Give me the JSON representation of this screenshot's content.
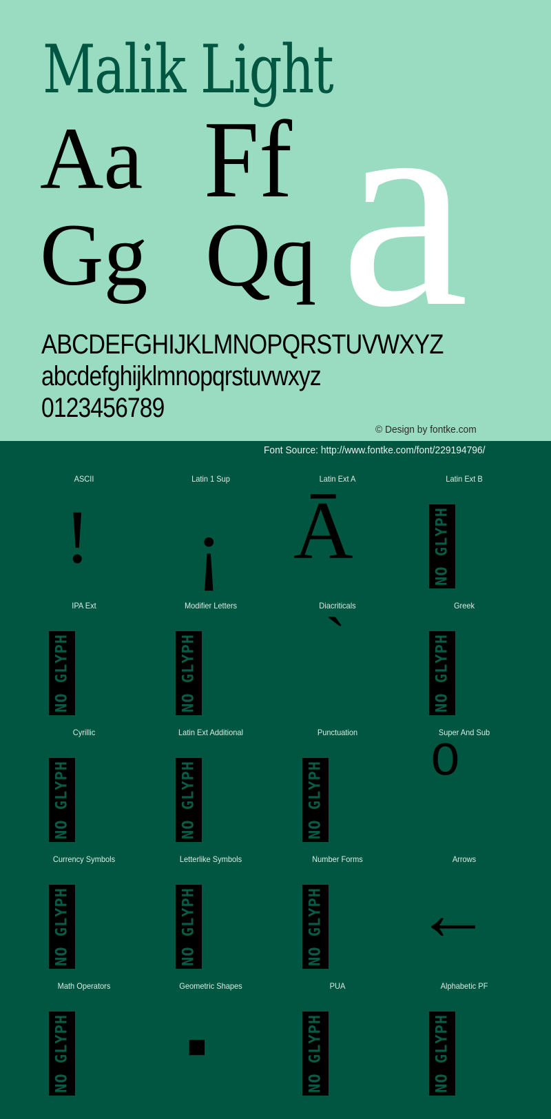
{
  "header": {
    "title": "Malik Light",
    "pairs": [
      "Aa",
      "Ff",
      "Gg",
      "Qq"
    ],
    "big_glyph": "a",
    "uppercase": "ABCDEFGHIJKLMNOPQRSTUVWXYZ",
    "lowercase": "abcdefghijklmnopqrstuvwxyz",
    "digits": "0123456789",
    "credit": "© Design by fontke.com",
    "source": "Font Source: http://www.fontke.com/font/229194796/"
  },
  "colors": {
    "top_bg": "#9adcc2",
    "bottom_bg": "#015641",
    "title": "#015641",
    "big_glyph": "#ffffff"
  },
  "no_glyph_text": "NO GLYPH",
  "blocks": [
    {
      "label": "ASCII",
      "glyph": "!",
      "has_glyph": true
    },
    {
      "label": "Latin 1 Sup",
      "glyph": "¡",
      "has_glyph": true
    },
    {
      "label": "Latin Ext A",
      "glyph": "Ā",
      "has_glyph": true
    },
    {
      "label": "Latin Ext B",
      "glyph": null,
      "has_glyph": false
    },
    {
      "label": "IPA Ext",
      "glyph": null,
      "has_glyph": false
    },
    {
      "label": "Modifier Letters",
      "glyph": null,
      "has_glyph": false
    },
    {
      "label": "Diacriticals",
      "glyph": "`",
      "has_glyph": true
    },
    {
      "label": "Greek",
      "glyph": null,
      "has_glyph": false
    },
    {
      "label": "Cyrillic",
      "glyph": null,
      "has_glyph": false
    },
    {
      "label": "Latin Ext Additional",
      "glyph": null,
      "has_glyph": false
    },
    {
      "label": "Punctuation",
      "glyph": null,
      "has_glyph": false
    },
    {
      "label": "Super And Sub",
      "glyph": "⁰",
      "has_glyph": true
    },
    {
      "label": "Currency Symbols",
      "glyph": null,
      "has_glyph": false
    },
    {
      "label": "Letterlike Symbols",
      "glyph": null,
      "has_glyph": false
    },
    {
      "label": "Number Forms",
      "glyph": null,
      "has_glyph": false
    },
    {
      "label": "Arrows",
      "glyph": "←",
      "has_glyph": true
    },
    {
      "label": "Math Operators",
      "glyph": null,
      "has_glyph": false
    },
    {
      "label": "Geometric Shapes",
      "glyph": "▪",
      "has_glyph": true
    },
    {
      "label": "PUA",
      "glyph": null,
      "has_glyph": false
    },
    {
      "label": "Alphabetic PF",
      "glyph": null,
      "has_glyph": false
    }
  ]
}
